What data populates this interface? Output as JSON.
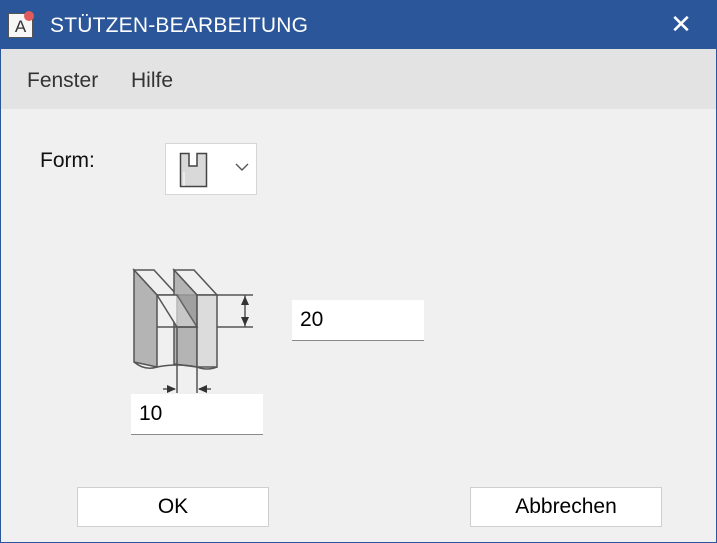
{
  "window": {
    "title": "STÜTZEN-BEARBEITUNG",
    "close_glyph": "✕",
    "app_icon_letter": "A"
  },
  "menu": {
    "items": [
      "Fenster",
      "Hilfe"
    ]
  },
  "form": {
    "label": "Form:",
    "shape_icon": "u-slot-shape-icon",
    "dropdown_glyph": "⌵"
  },
  "dimensions": {
    "height_value": "20",
    "width_value": "10"
  },
  "buttons": {
    "ok": "OK",
    "cancel": "Abbrechen"
  },
  "colors": {
    "titlebar": "#2b579a",
    "background": "#f0f0f0",
    "menubar": "#e3e3e3"
  }
}
